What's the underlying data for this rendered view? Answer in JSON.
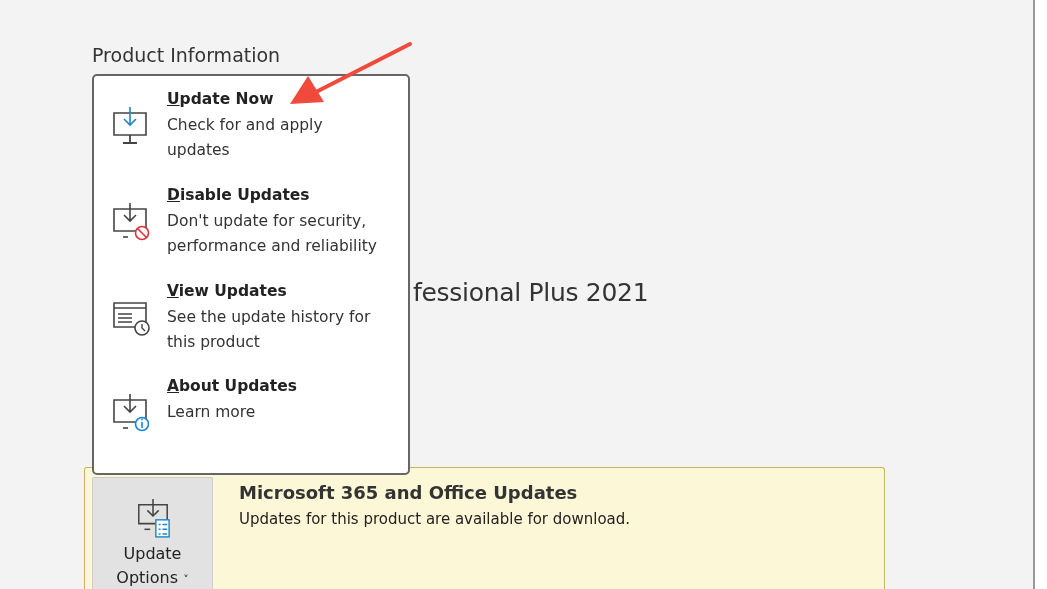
{
  "section_title": "Product Information",
  "product_name": "fessional Plus 2021",
  "updates_panel": {
    "title": "Microsoft 365 and Office Updates",
    "message": "Updates for this product are available for download.",
    "button": {
      "line1": "Update",
      "line2": "Options",
      "caret": "˅"
    }
  },
  "menu": {
    "items": [
      {
        "kind": "update",
        "title": "Update Now",
        "description": "Check for and apply updates"
      },
      {
        "kind": "disable",
        "title": "Disable Updates",
        "description": "Don't update for security, performance and reliability"
      },
      {
        "kind": "view",
        "title": "View Updates",
        "description": "See the update history for this product"
      },
      {
        "kind": "about",
        "title": "About Updates",
        "description": "Learn more"
      }
    ]
  }
}
